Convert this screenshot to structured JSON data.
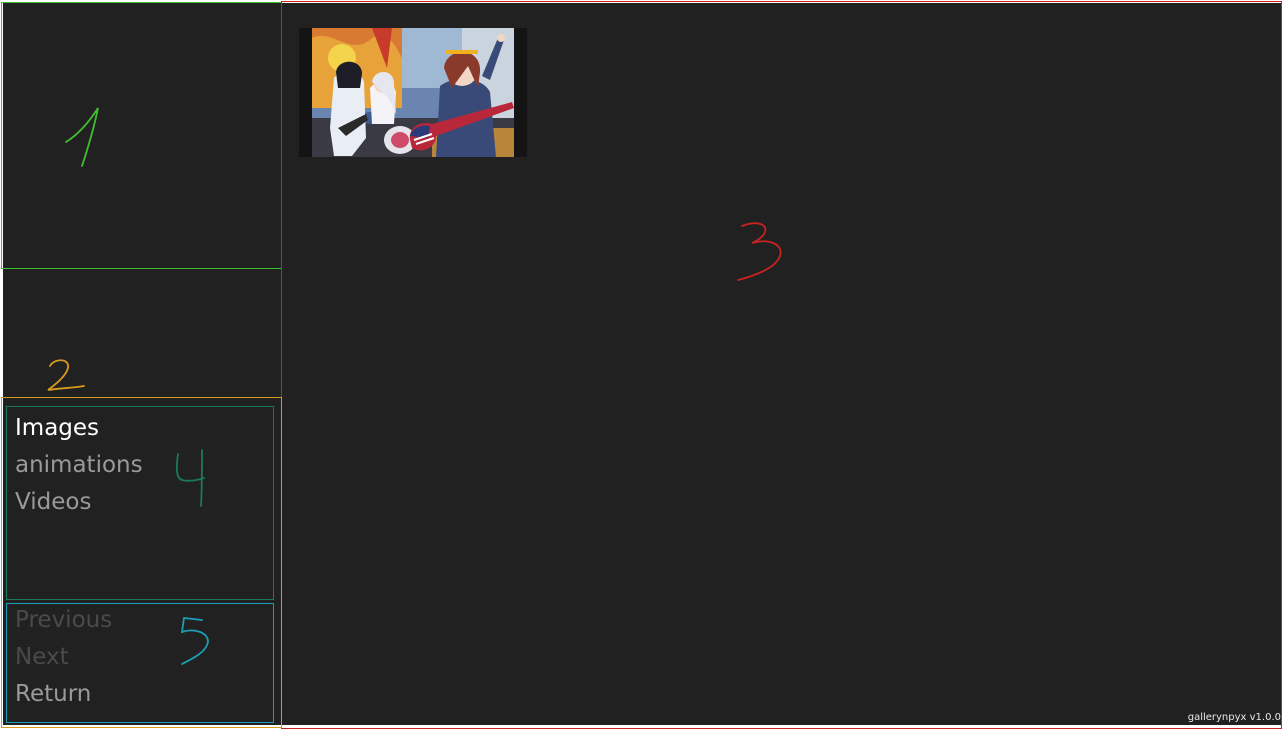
{
  "nav": {
    "items": [
      {
        "label": "Images",
        "state": "active"
      },
      {
        "label": "animations",
        "state": "inactive"
      },
      {
        "label": "Videos",
        "state": "inactive"
      }
    ]
  },
  "controls": {
    "previous_label": "Previous",
    "next_label": "Next",
    "return_label": "Return"
  },
  "annotations": {
    "region_1": "1",
    "region_2": "2",
    "region_3": "3",
    "region_4": "4",
    "region_5": "5"
  },
  "colors": {
    "background": "#212121",
    "region_1": "#3fbf2f",
    "region_2": "#d89a1c",
    "region_3": "#c8231e",
    "region_4": "#1b7a58",
    "region_5": "#1b9db3",
    "active_text": "#ffffff",
    "inactive_text": "#9a9a9a",
    "disabled_text": "#4a4a4a"
  },
  "gallery": {
    "thumbnails": [
      {
        "icon": "anime-band-thumbnail"
      }
    ]
  },
  "footer": {
    "version": "gallerynpyx v1.0.0"
  }
}
